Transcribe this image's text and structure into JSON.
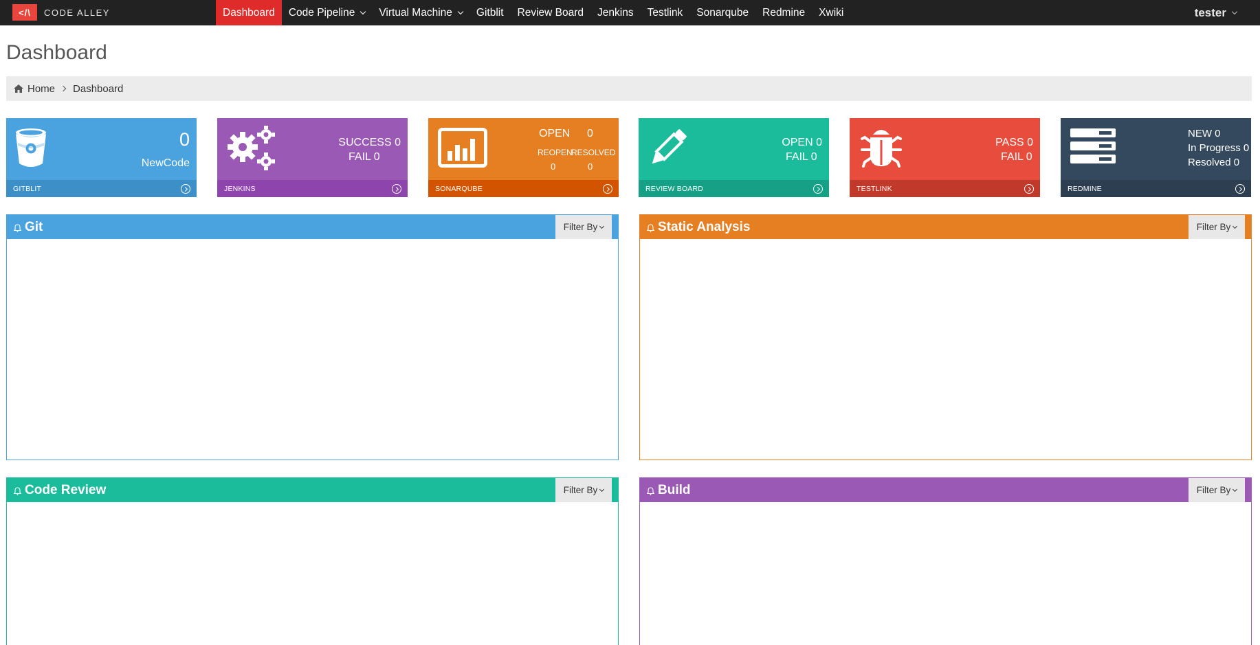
{
  "brand": {
    "logo": "</\\",
    "name": "CODE ALLEY"
  },
  "nav": [
    {
      "label": "Dashboard",
      "active": true,
      "dropdown": false
    },
    {
      "label": "Code Pipeline",
      "active": false,
      "dropdown": true
    },
    {
      "label": "Virtual Machine",
      "active": false,
      "dropdown": true
    },
    {
      "label": "Gitblit",
      "active": false,
      "dropdown": false
    },
    {
      "label": "Review Board",
      "active": false,
      "dropdown": false
    },
    {
      "label": "Jenkins",
      "active": false,
      "dropdown": false
    },
    {
      "label": "Testlink",
      "active": false,
      "dropdown": false
    },
    {
      "label": "Sonarqube",
      "active": false,
      "dropdown": false
    },
    {
      "label": "Redmine",
      "active": false,
      "dropdown": false
    },
    {
      "label": "Xwiki",
      "active": false,
      "dropdown": false
    }
  ],
  "user": "tester",
  "page_title": "Dashboard",
  "breadcrumb": {
    "home": "Home",
    "current": "Dashboard"
  },
  "tiles": {
    "gitblit": {
      "label": "GITBLIT",
      "value": "0",
      "sub": "NewCode",
      "icon": "bucket-icon",
      "color": "#4aa3df",
      "foot_color": "#3d8fc7"
    },
    "jenkins": {
      "label": "JENKINS",
      "line1": "SUCCESS 0",
      "line2": "FAIL 0",
      "icon": "gears-icon",
      "color": "#9b59b6",
      "foot_color": "#8e44ad"
    },
    "sonarqube": {
      "label": "SONARQUBE",
      "open_label": "OPEN",
      "open_value": "0",
      "reopen_label": "REOPEN",
      "resolved_label": "RESOLVED",
      "reopen_value": "0",
      "resolved_value": "0",
      "icon": "bar-chart-icon",
      "color": "#e67e22",
      "foot_color": "#d35400"
    },
    "review_board": {
      "label": "REVIEW BOARD",
      "line1": "OPEN 0",
      "line2": "FAIL 0",
      "icon": "pencil-icon",
      "color": "#1abc9c",
      "foot_color": "#16a085"
    },
    "testlink": {
      "label": "TESTLINK",
      "line1": "PASS 0",
      "line2": "FAIL 0",
      "icon": "bug-icon",
      "color": "#e74c3c",
      "foot_color": "#c0392b"
    },
    "redmine": {
      "label": "REDMINE",
      "line1": "NEW 0",
      "line2": "In Progress 0",
      "line3": "Resolved 0",
      "icon": "server-icon",
      "color": "#34495e",
      "foot_color": "#2c3e50"
    }
  },
  "panels": {
    "git": {
      "title": "Git",
      "filter": "Filter By",
      "color": "#4aa3df"
    },
    "static_analysis": {
      "title": "Static Analysis",
      "filter": "Filter By",
      "color": "#e67e22"
    },
    "code_review": {
      "title": "Code Review",
      "filter": "Filter By",
      "color": "#1abc9c"
    },
    "build": {
      "title": "Build",
      "filter": "Filter By",
      "color": "#9b59b6"
    }
  }
}
